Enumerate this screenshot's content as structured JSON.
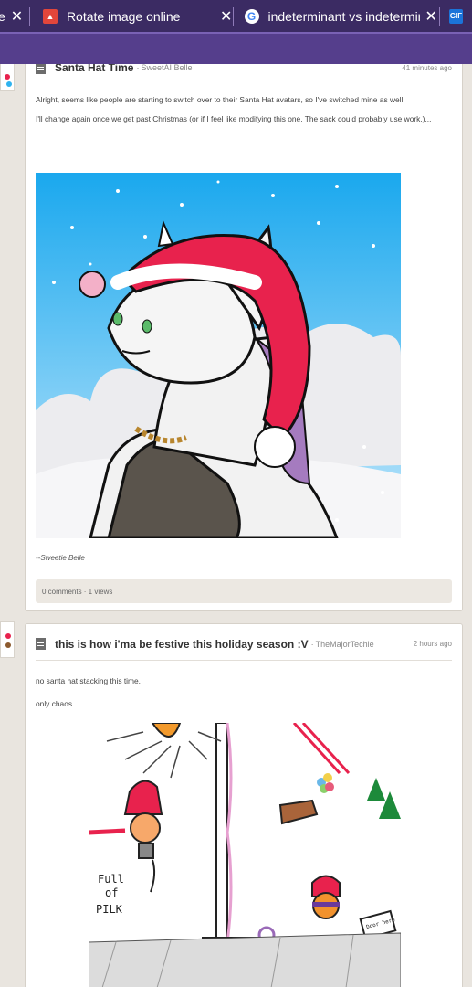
{
  "browser": {
    "tabs": [
      {
        "label": "e",
        "close": "✕"
      },
      {
        "label": "Rotate image online",
        "close": "✕",
        "icon": "rotate-image-favicon"
      },
      {
        "label": "indeterminant vs indeterminat",
        "close": "✕",
        "icon": "google-favicon"
      },
      {
        "label": "GIF",
        "icon": "gif-favicon"
      }
    ]
  },
  "posts": [
    {
      "title": "Santa Hat Time",
      "author": "SweetAI Belle",
      "time": "41 minutes ago",
      "paragraphs": [
        "Alright, seems like people are starting to switch over to their Santa Hat avatars, so I've switched mine as well.",
        "I'll change again once we get past Christmas (or if I feel like modifying this one. The sack could probably use work.)..."
      ],
      "signature": "--Sweetie Belle",
      "stats": "0 comments · 1 views"
    },
    {
      "title": "this is how i'ma be festive this holiday season :V",
      "author": "TheMajorTechie",
      "time": "2 hours ago",
      "paragraphs": [
        "no santa hat stacking this time.",
        "only chaos."
      ],
      "drawing_text": {
        "pilk": "Full of PILK",
        "box": "Cookys",
        "sign": "Door here"
      }
    }
  ],
  "colors": {
    "tabstrip": "#3b2b63",
    "addressbar": "#553e8c",
    "page_bg": "#e9e5df",
    "santa_red": "#e8224d",
    "sky": "#2fb3ef"
  }
}
